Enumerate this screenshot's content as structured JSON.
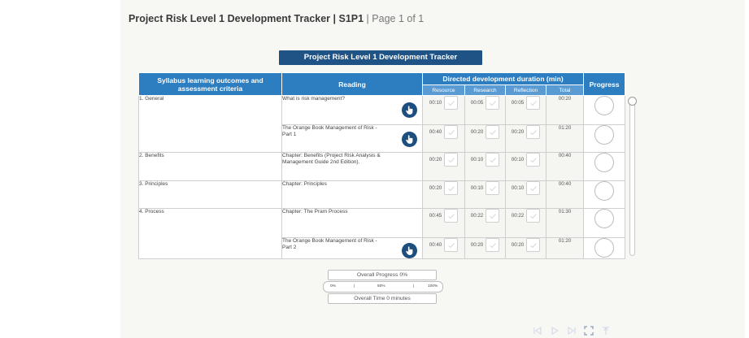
{
  "header": {
    "title": "Project Risk Level 1 Development Tracker | S1P1",
    "page_info": "Page 1 of 1",
    "separator": "|"
  },
  "banner": "Project Risk Level 1 Development Tracker",
  "table": {
    "headers": {
      "outcomes": "Syllabus learning outcomes and assessment criteria",
      "reading": "Reading",
      "duration": "Directed development duration (min)",
      "progress": "Progress",
      "resource": "Resource",
      "research": "Research",
      "reflection": "Reflection",
      "total": "Total"
    },
    "rows": [
      {
        "outcome": "1. General",
        "reading": "What is risk management?",
        "resource": "00:10",
        "research": "00:05",
        "reflection": "00:05",
        "total": "00:20"
      },
      {
        "outcome": "",
        "reading": "The Orange Book Management of Risk - Part 1",
        "resource": "00:40",
        "research": "00:20",
        "reflection": "00:20",
        "total": "01:20"
      },
      {
        "outcome": "2. Benefits",
        "reading": "Chapter: Benefits (Project Risk Analysis & Management Guide 2nd Edition).",
        "resource": "00:20",
        "research": "00:10",
        "reflection": "00:10",
        "total": "00:40"
      },
      {
        "outcome": "3. Principles",
        "reading": "Chapter: Principles",
        "resource": "00:20",
        "research": "00:10",
        "reflection": "00:10",
        "total": "00:40"
      },
      {
        "outcome": "4. Process",
        "reading": "Chapter: The Pram Process",
        "resource": "00:45",
        "research": "00:22",
        "reflection": "00:22",
        "total": "01:30"
      },
      {
        "outcome": "",
        "reading": "The Orange Book Management of Risk - Part 2",
        "resource": "00:40",
        "research": "00:20",
        "reflection": "00:20",
        "total": "01:20"
      }
    ]
  },
  "overall": {
    "progress_label": "Overall Progress 0%",
    "time_label": "Overall Time 0 minutes",
    "scale_min": "0%",
    "scale_mid": "50%",
    "scale_max": "100%",
    "progress_value": 0
  },
  "icons": {
    "hand": "hand-pointer-icon",
    "check": "checkmark-icon",
    "nav": [
      "first-page-icon",
      "play-icon",
      "last-page-icon",
      "fullscreen-icon",
      "pin-icon"
    ]
  },
  "colors": {
    "header_blue": "#2d7dc1",
    "banner_navy": "#1f5285",
    "subheader_blue": "#5b9bd4"
  }
}
